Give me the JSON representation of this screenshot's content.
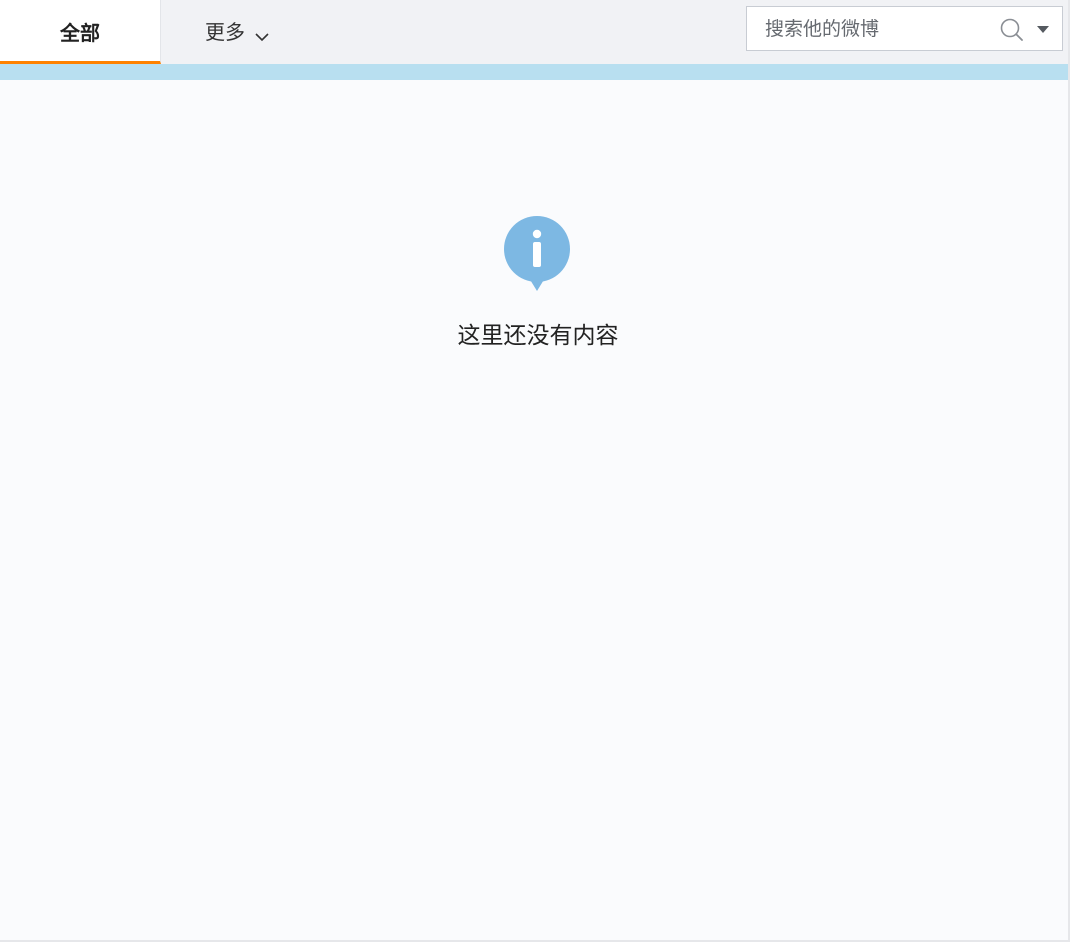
{
  "tabs": {
    "all_label": "全部",
    "more_label": "更多"
  },
  "search": {
    "placeholder": "搜索他的微博"
  },
  "empty_state": {
    "message": "这里还没有内容"
  },
  "colors": {
    "active_tab_underline": "#ff8200",
    "info_strip": "#b8dff0",
    "info_icon": "#7db8e3"
  },
  "icons": {
    "chevron": "chevron-down-icon",
    "search": "search-icon",
    "dropdown": "caret-down-icon",
    "info": "info-icon"
  }
}
